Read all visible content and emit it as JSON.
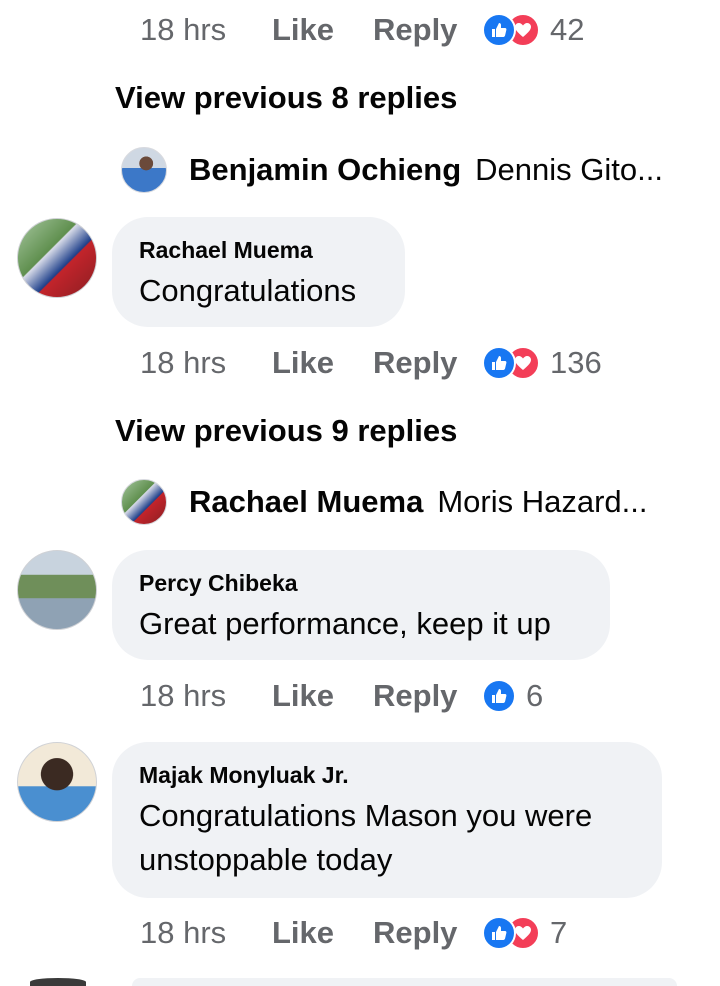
{
  "colors": {
    "meta_text": "#65676b",
    "bubble_bg": "#f0f2f5",
    "like_blue": "#1877f2",
    "love_red": "#f33e58"
  },
  "top_meta": {
    "time": "18 hrs",
    "like_label": "Like",
    "reply_label": "Reply",
    "reactions": [
      "like-icon",
      "love-icon"
    ],
    "count": "42"
  },
  "threads": [
    {
      "view_previous": "View previous 8 replies",
      "preview_author": "Benjamin Ochieng",
      "preview_text": "Dennis Gito..."
    },
    {
      "view_previous": "View previous 9 replies",
      "preview_author": "Rachael Muema",
      "preview_text": "Moris Hazard..."
    }
  ],
  "comments": [
    {
      "author": "Rachael Muema",
      "text": "Congratulations",
      "time": "18 hrs",
      "like_label": "Like",
      "reply_label": "Reply",
      "reactions": [
        "like-icon",
        "love-icon"
      ],
      "count": "136"
    },
    {
      "author": "Percy Chibeka",
      "text": "Great performance, keep it up",
      "time": "18 hrs",
      "like_label": "Like",
      "reply_label": "Reply",
      "reactions": [
        "like-icon"
      ],
      "count": "6"
    },
    {
      "author": "Majak Monyluak Jr.",
      "text": "Congratulations Mason you were unstoppable today",
      "time": "18 hrs",
      "like_label": "Like",
      "reply_label": "Reply",
      "reactions": [
        "like-icon",
        "love-icon"
      ],
      "count": "7"
    }
  ]
}
